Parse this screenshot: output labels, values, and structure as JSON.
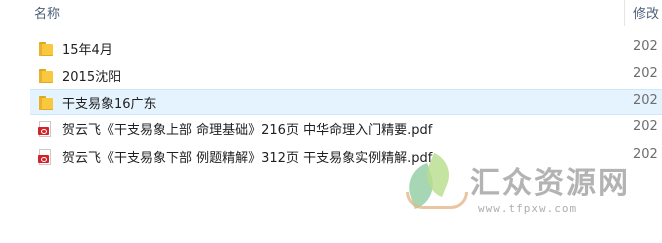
{
  "columns": {
    "name": "名称",
    "modified": "修改"
  },
  "files": [
    {
      "name": "15年4月",
      "type": "folder",
      "date": "202",
      "hover": false
    },
    {
      "name": "2015沈阳",
      "type": "folder",
      "date": "202",
      "hover": false
    },
    {
      "name": "干支易象16广东",
      "type": "folder",
      "date": "202",
      "hover": true
    },
    {
      "name": "贺云飞《干支易象上部 命理基础》216页 中华命理入门精要.pdf",
      "type": "pdf",
      "date": "202",
      "hover": false
    },
    {
      "name": "贺云飞《干支易象下部 例题精解》312页 干支易象实例精解.pdf",
      "type": "pdf",
      "date": "202",
      "hover": false
    }
  ],
  "watermark": {
    "title": "汇众资源网",
    "url": "www.tfpxw.com"
  }
}
